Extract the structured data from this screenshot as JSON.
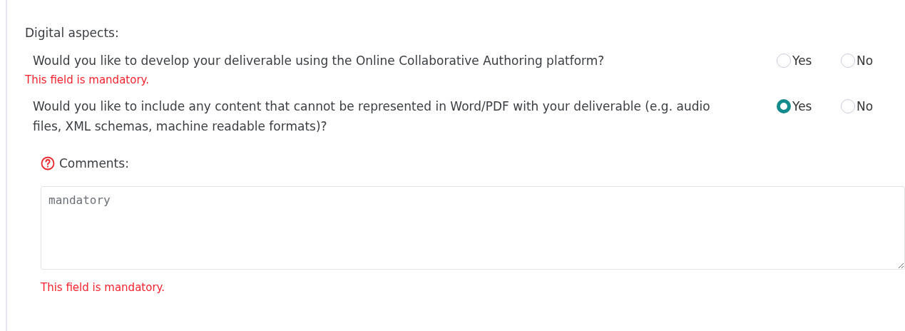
{
  "section": {
    "title": "Digital aspects:"
  },
  "questions": [
    {
      "text": "Would you like to develop your deliverable using the Online Collaborative Authoring platform?",
      "options": [
        {
          "label": "Yes",
          "selected": false
        },
        {
          "label": "No",
          "selected": false
        }
      ],
      "error": "This field is mandatory."
    },
    {
      "text": "Would you like to include any content that cannot be represented in Word/PDF with your deliverable (e.g. audio files, XML schemas, machine readable formats)?",
      "options": [
        {
          "label": "Yes",
          "selected": true
        },
        {
          "label": "No",
          "selected": false
        }
      ]
    }
  ],
  "comments": {
    "label": "Comments:",
    "placeholder": "mandatory",
    "error": "This field is mandatory."
  }
}
